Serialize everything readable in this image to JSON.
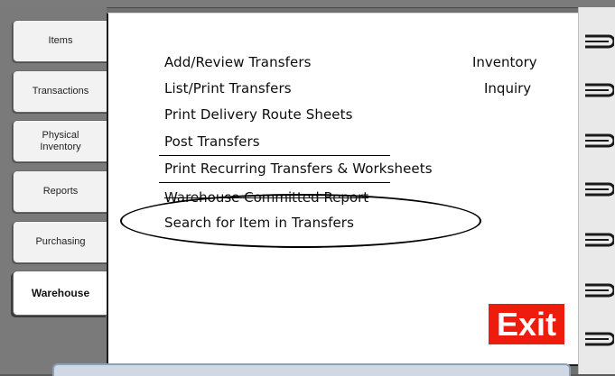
{
  "tabs": [
    {
      "label": "Items"
    },
    {
      "label": "Transactions"
    },
    {
      "label": "Physical\nInventory"
    },
    {
      "label": "Reports"
    },
    {
      "label": "Purchasing"
    },
    {
      "label": "Warehouse",
      "active": true
    }
  ],
  "menu": {
    "items": [
      "Add/Review Transfers",
      "List/Print Transfers",
      "Print Delivery Route Sheets",
      "Post Transfers",
      "Print Recurring Transfers & Worksheets",
      "Warehouse Committed Report",
      "Search for Item in Transfers"
    ],
    "side_items": [
      "Inventory",
      "Inquiry"
    ]
  },
  "exit_label": "Exit",
  "colors": {
    "exit_bg": "#ee1c0c",
    "page_bg": "#ffffff",
    "frame_bg": "#6f6f6f"
  },
  "icons": {
    "ring": "spiral-ring-icon",
    "annotation": "ellipse-annotation"
  }
}
